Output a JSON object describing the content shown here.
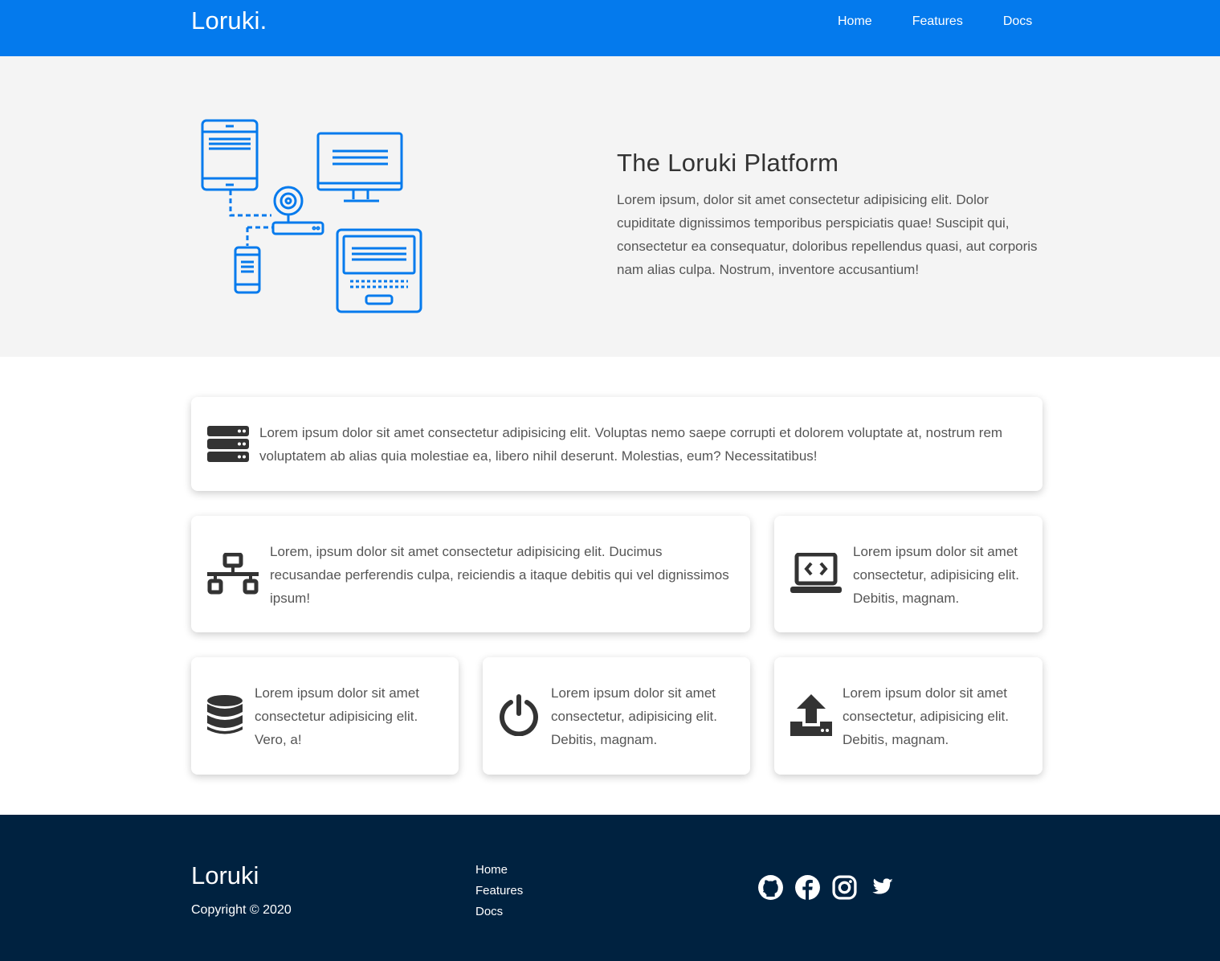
{
  "header": {
    "logo": "Loruki.",
    "nav": [
      "Home",
      "Features",
      "Docs"
    ]
  },
  "showcase": {
    "title": "The Loruki Platform",
    "text": "Lorem ipsum, dolor sit amet consectetur adipisicing elit. Dolor cupiditate dignissimos temporibus perspiciatis quae! Suscipit qui, consectetur ea consequatur, doloribus repellendus quasi, aut corporis nam alias culpa. Nostrum, inventore accusantium!",
    "illustration_icon": "devices-network-icon"
  },
  "features": [
    {
      "icon": "server-icon",
      "text": "Lorem ipsum dolor sit amet consectetur adipisicing elit. Voluptas nemo saepe corrupti et dolorem voluptate at, nostrum rem voluptatem ab alias quia molestiae ea, libero nihil deserunt. Molestias, eum? Necessitatibus!"
    },
    {
      "icon": "network-wired-icon",
      "text": "Lorem, ipsum dolor sit amet consectetur adipisicing elit. Ducimus recusandae perferendis culpa, reiciendis a itaque debitis qui vel dignissimos ipsum!"
    },
    {
      "icon": "laptop-code-icon",
      "text": "Lorem ipsum dolor sit amet consectetur, adipisicing elit. Debitis, magnam."
    },
    {
      "icon": "database-icon",
      "text": "Lorem ipsum dolor sit amet consectetur adipisicing elit. Vero, a!"
    },
    {
      "icon": "power-off-icon",
      "text": "Lorem ipsum dolor sit amet consectetur, adipisicing elit. Debitis, magnam."
    },
    {
      "icon": "upload-icon",
      "text": "Lorem ipsum dolor sit amet consectetur, adipisicing elit. Debitis, magnam."
    }
  ],
  "footer": {
    "brand": "Loruki",
    "copyright": "Copyright © 2020",
    "links": [
      "Home",
      "Features",
      "Docs"
    ],
    "social": [
      "github-icon",
      "facebook-icon",
      "instagram-icon",
      "twitter-icon"
    ]
  },
  "colors": {
    "primary": "#047aed",
    "light": "#f4f4f4",
    "dark": "#002240",
    "icon": "#333333"
  }
}
